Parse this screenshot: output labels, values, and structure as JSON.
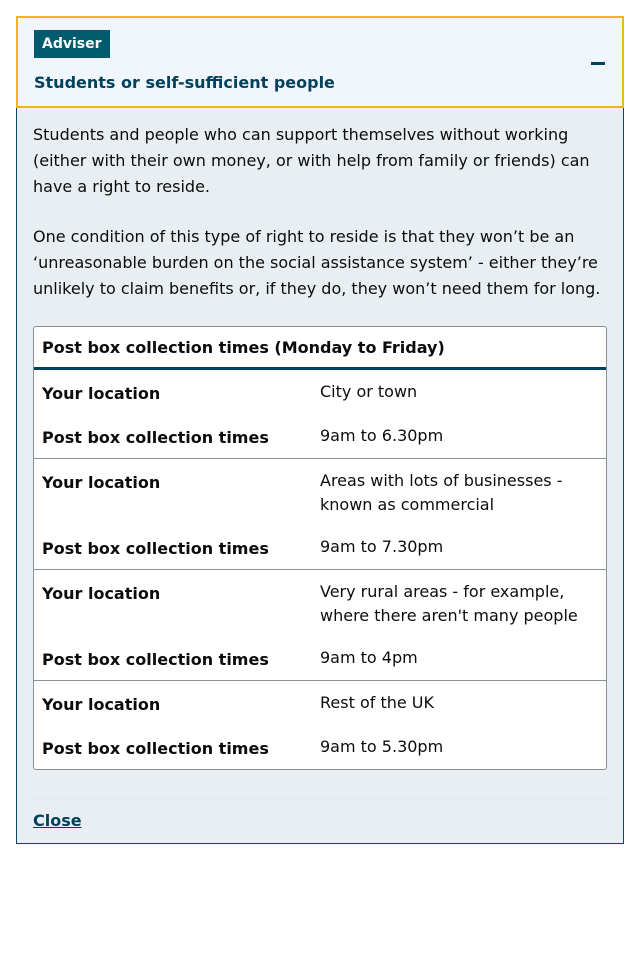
{
  "accordion": {
    "badge": "Adviser",
    "title": "Students or self-sufficient people",
    "toggle_icon": "minus-icon",
    "paragraphs": [
      "Students and people who can support themselves without working (either with their own money, or with help from family or friends) can have a right to reside.",
      "One condition of this type of right to reside is that they won’t be an ‘unreasonable burden on the social assistance system’ - either they’re unlikely to claim benefits or, if they do, they won’t need them for long."
    ],
    "close_label": "Close"
  },
  "table": {
    "caption": "Post box collection times (Monday to Friday)",
    "rows": [
      {
        "location_label": "Your location",
        "location": "City or town",
        "times_label": "Post box collection times",
        "times": "9am to 6.30pm"
      },
      {
        "location_label": "Your location",
        "location": "Areas with lots of businesses - known as commercial",
        "times_label": "Post box collection times",
        "times": "9am to 7.30pm"
      },
      {
        "location_label": "Your location",
        "location": "Very rural areas - for example, where there aren't many people",
        "times_label": "Post box collection times",
        "times": "9am to 4pm"
      },
      {
        "location_label": "Your location",
        "location": "Rest of the UK",
        "times_label": "Post box collection times",
        "times": "9am to 5.30pm"
      }
    ]
  },
  "colors": {
    "badge_bg": "#005b6e",
    "title": "#00415c",
    "focus_border": "#f0b51c",
    "body_bg": "#e8eef1"
  }
}
